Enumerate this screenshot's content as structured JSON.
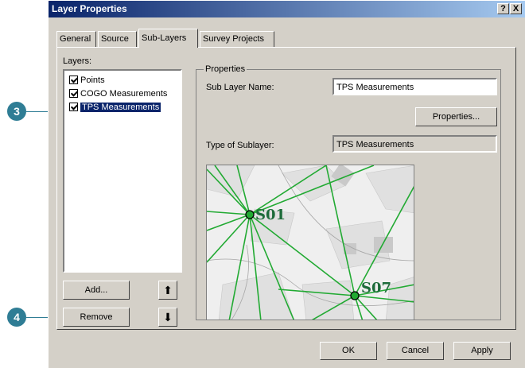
{
  "window": {
    "title": "Layer Properties",
    "help_btn": "?",
    "close_btn": "X"
  },
  "tabs": [
    {
      "label": "General"
    },
    {
      "label": "Source"
    },
    {
      "label": "Sub-Layers"
    },
    {
      "label": "Survey Projects"
    }
  ],
  "layers_label": "Layers:",
  "layers": [
    {
      "label": "Points",
      "checked": true,
      "selected": false
    },
    {
      "label": "COGO Measurements",
      "checked": true,
      "selected": false
    },
    {
      "label": "TPS Measurements",
      "checked": true,
      "selected": true
    }
  ],
  "buttons": {
    "add": "Add...",
    "remove": "Remove",
    "move_up": "⬆",
    "move_down": "⬇"
  },
  "properties": {
    "group_label": "Properties",
    "sub_layer_name_label": "Sub Layer Name:",
    "sub_layer_name_value": "TPS Measurements",
    "properties_button": "Properties...",
    "type_label": "Type of Sublayer:",
    "type_value": "TPS Measurements"
  },
  "map": {
    "point1": "S01",
    "point2": "S07"
  },
  "footer": {
    "ok": "OK",
    "cancel": "Cancel",
    "apply": "Apply"
  },
  "callouts": {
    "c3": "3",
    "c4": "4"
  },
  "colors": {
    "accent": "#2f7d95",
    "title_bar": "#0a246a",
    "measurement_lines": "#22aa33"
  }
}
